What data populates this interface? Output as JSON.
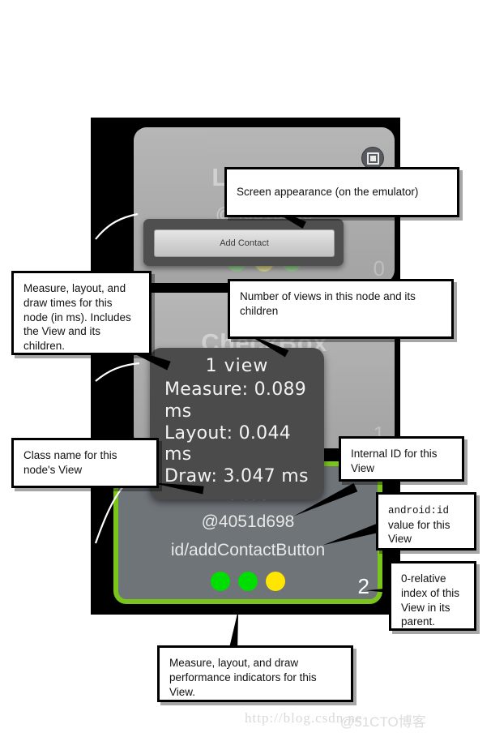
{
  "tree": {
    "nodes": [
      {
        "title": "ListView",
        "internal_id": "@4051d298",
        "android_id": "",
        "index": "0",
        "dots": [
          "#9fd69a",
          "#e4e09a",
          "#9fd69a"
        ],
        "selected": false
      },
      {
        "title": "CheckBox",
        "internal_id": "",
        "android_id": "",
        "index": "1",
        "dots": [
          "#e4e09a",
          "#9fd69a",
          "#9fd69a"
        ],
        "selected": false
      },
      {
        "title": "Button",
        "internal_id": "@4051d698",
        "android_id": "id/addContactButton",
        "index": "2",
        "dots": [
          "#00dd00",
          "#00dd00",
          "#ffe500"
        ],
        "selected": true
      }
    ],
    "capture_icon": "screenshot-capture-icon"
  },
  "emulator_preview": {
    "button_label": "Add Contact"
  },
  "perf_tooltip": {
    "view_count": "1 view",
    "measure": "Measure: 0.089 ms",
    "layout": "Layout: 0.044 ms",
    "draw": "Draw: 3.047 ms"
  },
  "callouts": {
    "screen_appearance": "Screen appearance (on the emulator)",
    "measure_times": "Measure, layout, and draw times for this node (in ms). Includes the View and its children.",
    "view_count": "Number of views in this node and its children",
    "class_name": "Class name for this node's View",
    "internal_id": "Internal ID for this View",
    "android_id_label": "android:id",
    "android_id_rest": "value for this View",
    "index_note": "0-relative index of this View in its parent.",
    "perf_indicators": "Measure, layout, and draw performance indicators for this View."
  },
  "watermark": {
    "url": "http://blog.csdn.ne",
    "tag": "@51CTO博客"
  },
  "colors": {
    "selection_green": "#7ac51c",
    "dot_green": "#00dd00",
    "dot_yellow": "#ffe500",
    "panel_black": "#000000",
    "tooltip_gray": "#4b4b4b"
  }
}
